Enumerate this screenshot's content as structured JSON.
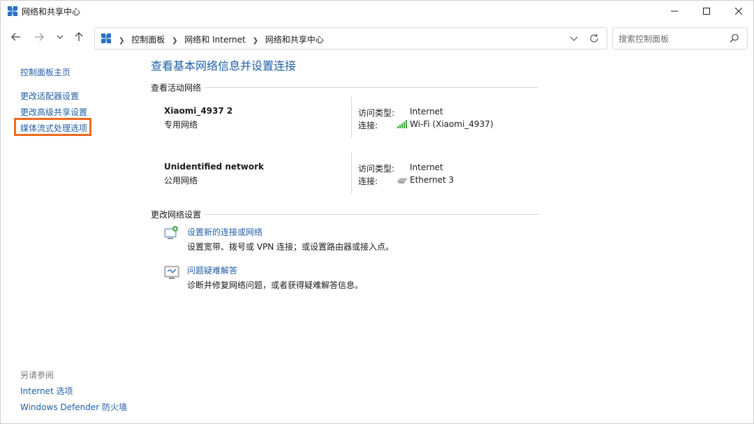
{
  "window": {
    "title": "网络和共享中心"
  },
  "breadcrumb": [
    "控制面板",
    "网络和 Internet",
    "网络和共享中心"
  ],
  "search": {
    "placeholder": "搜索控制面板"
  },
  "sidebar": {
    "home": "控制面板主页",
    "items": [
      "更改适配器设置",
      "更改高级共享设置",
      "媒体流式处理选项"
    ],
    "see_also_title": "另请参阅",
    "see_also": [
      "Internet 选项",
      "Windows Defender 防火墙"
    ]
  },
  "main": {
    "title": "查看基本网络信息并设置连接",
    "active_networks_heading": "查看活动网络",
    "networks": [
      {
        "name": "Xiaomi_4937 2",
        "type": "专用网络",
        "access_label": "访问类型:",
        "access_value": "Internet",
        "conn_label": "连接:",
        "conn_value": "Wi-Fi (Xiaomi_4937)",
        "conn_icon": "wifi-signal-icon"
      },
      {
        "name": "Unidentified network",
        "type": "公用网络",
        "access_label": "访问类型:",
        "access_value": "Internet",
        "conn_label": "连接:",
        "conn_value": "Ethernet 3",
        "conn_icon": "ethernet-icon"
      }
    ],
    "change_settings_heading": "更改网络设置",
    "tasks": [
      {
        "link": "设置新的连接或网络",
        "desc": "设置宽带、拨号或 VPN 连接；或设置路由器或接入点。",
        "icon": "new-connection-icon"
      },
      {
        "link": "问题疑难解答",
        "desc": "诊断并修复网络问题，或者获得疑难解答信息。",
        "icon": "troubleshoot-icon"
      }
    ]
  },
  "colors": {
    "link": "#1f5fa6",
    "highlight": "#ef6b20",
    "wifi": "#3aa53a"
  }
}
